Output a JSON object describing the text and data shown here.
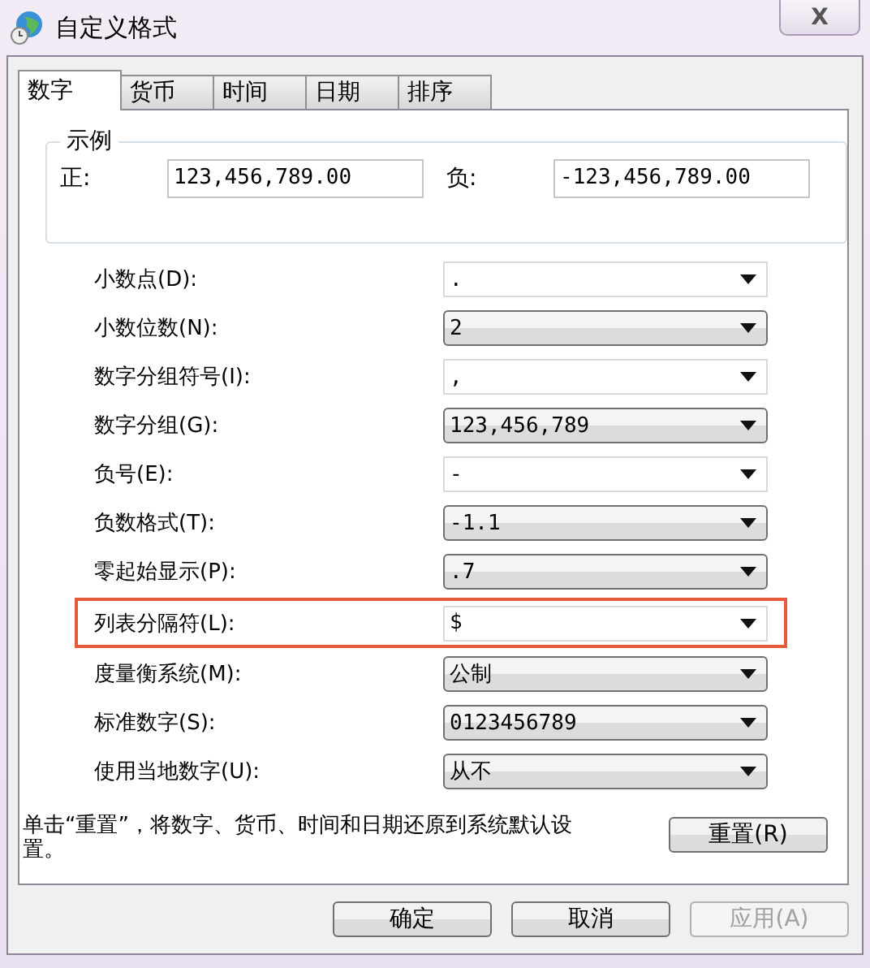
{
  "window": {
    "title": "自定义格式",
    "close": "X"
  },
  "tabs": [
    {
      "label": "数字",
      "selected": true
    },
    {
      "label": "货币",
      "selected": false
    },
    {
      "label": "时间",
      "selected": false
    },
    {
      "label": "日期",
      "selected": false
    },
    {
      "label": "排序",
      "selected": false
    }
  ],
  "example": {
    "title": "示例",
    "positive_label": "正:",
    "positive_value": "123,456,789.00",
    "negative_label": "负:",
    "negative_value": "-123,456,789.00"
  },
  "settings": [
    {
      "label": "小数点(D):",
      "value": ".",
      "kind": "editable",
      "highlighted": false
    },
    {
      "label": "小数位数(N):",
      "value": "2",
      "kind": "list",
      "highlighted": false
    },
    {
      "label": "数字分组符号(I):",
      "value": ",",
      "kind": "editable",
      "highlighted": false
    },
    {
      "label": "数字分组(G):",
      "value": "123,456,789",
      "kind": "list",
      "highlighted": false
    },
    {
      "label": "负号(E):",
      "value": "-",
      "kind": "editable",
      "highlighted": false
    },
    {
      "label": "负数格式(T):",
      "value": "-1.1",
      "kind": "list",
      "highlighted": false
    },
    {
      "label": "零起始显示(P):",
      "value": ".7",
      "kind": "list",
      "highlighted": false
    },
    {
      "label": "列表分隔符(L):",
      "value": "$",
      "kind": "editable",
      "highlighted": true
    },
    {
      "label": "度量衡系统(M):",
      "value": "公制",
      "kind": "list",
      "highlighted": false
    },
    {
      "label": "标准数字(S):",
      "value": "0123456789",
      "kind": "list",
      "highlighted": false
    },
    {
      "label": "使用当地数字(U):",
      "value": "从不",
      "kind": "list",
      "highlighted": false
    }
  ],
  "reset": {
    "note": "单击“重置”，将数字、货币、时间和日期还原到系统默认设置。",
    "button": "重置(R)"
  },
  "buttons": [
    {
      "label": "确定",
      "disabled": false
    },
    {
      "label": "取消",
      "disabled": false
    },
    {
      "label": "应用(A)",
      "disabled": true
    }
  ]
}
